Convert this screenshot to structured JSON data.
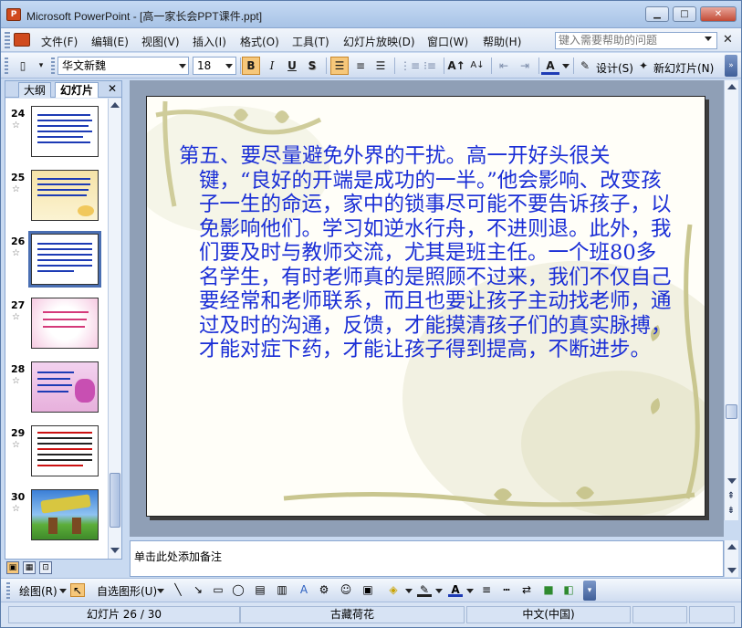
{
  "window": {
    "title": "Microsoft PowerPoint - [高一家长会PPT课件.ppt]",
    "app_icon": "powerpoint-icon",
    "minimize": "▁",
    "maximize": "□",
    "close": "✕"
  },
  "menu": {
    "items": [
      "文件(F)",
      "编辑(E)",
      "视图(V)",
      "插入(I)",
      "格式(O)",
      "工具(T)",
      "幻灯片放映(D)",
      "窗口(W)",
      "帮助(H)"
    ],
    "help_placeholder": "键入需要帮助的问题",
    "doc_close": "✕"
  },
  "toolbar": {
    "font_name": "华文新魏",
    "font_size": "18",
    "bold": "B",
    "italic": "I",
    "underline": "U",
    "shadow": "S",
    "design_label": "设计(S)",
    "new_slide_label": "新幻灯片(N)"
  },
  "left_pane": {
    "tabs": [
      "大纲",
      "幻灯片"
    ],
    "selected_tab": "幻灯片",
    "close": "✕",
    "thumbnails": [
      {
        "num": "24",
        "star": "☆"
      },
      {
        "num": "25",
        "star": "☆"
      },
      {
        "num": "26",
        "star": "☆"
      },
      {
        "num": "27",
        "star": "☆"
      },
      {
        "num": "28",
        "star": "☆"
      },
      {
        "num": "29",
        "star": "☆"
      },
      {
        "num": "30",
        "star": "☆"
      }
    ],
    "selected_slide": "26"
  },
  "slide": {
    "body": "第五、要尽量避免外界的干扰。高一开好头很关键，“良好的开端是成功的一半。”他会影响、改变孩子一生的命运，家中的锁事尽可能不要告诉孩子，以免影响他们。学习如逆水行舟，不进则退。此外，我们要及时与教师交流，尤其是班主任。一个班80多名学生，有时老师真的是照顾不过来，我们不仅自己要经常和老师联系，而且也要让孩子主动找老师，通过及时的沟通，反馈，才能摸清孩子们的真实脉搏，才能对症下药，才能让孩子得到提高，不断进步。",
    "text_color": "#1a2ed6"
  },
  "notes": {
    "placeholder": "单击此处添加备注"
  },
  "drawbar": {
    "draw_label": "绘图(R)",
    "autoshape_label": "自选图形(U)"
  },
  "status": {
    "slide_pos": "幻灯片 26 / 30",
    "design": "古藏荷花",
    "language": "中文(中国)"
  }
}
